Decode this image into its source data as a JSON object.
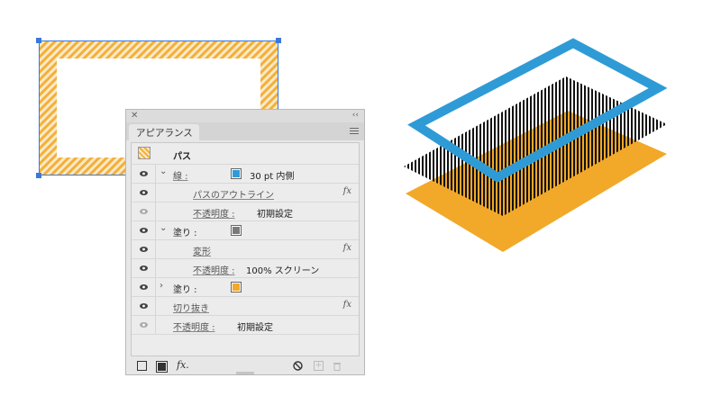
{
  "panel": {
    "tab_label": "アピアランス",
    "object_label": "パス",
    "rows": [
      {
        "label": "線 :",
        "value": "30 pt 内側",
        "swatch_color": "#2f9bd6"
      },
      {
        "label": "パスのアウトライン"
      },
      {
        "label": "不透明度 :",
        "value": "初期設定"
      },
      {
        "label": "塗り :",
        "swatch_color": "#7a7a7a"
      },
      {
        "label": "変形"
      },
      {
        "label": "不透明度 :",
        "value": "100% スクリーン"
      },
      {
        "label": "塗り :",
        "swatch_color": "#f2a829"
      },
      {
        "label": "切り抜き"
      },
      {
        "label": "不透明度 :",
        "value": "初期設定"
      }
    ],
    "fx_glyph": "fx",
    "bottom_fx_glyph": "fx."
  },
  "colors": {
    "stroke_blue": "#2f9bd6",
    "fill_orange": "#f2a829",
    "selection_blue": "#3c78d8"
  }
}
